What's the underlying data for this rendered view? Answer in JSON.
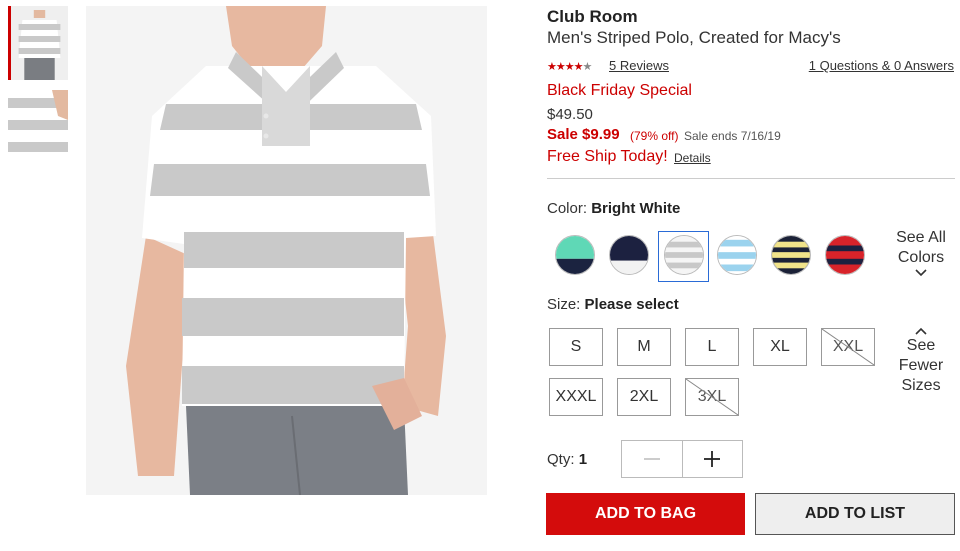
{
  "gallery": {
    "thumbnails": [
      "thumbnail-front",
      "thumbnail-detail"
    ],
    "selected_index": 0,
    "main_image": "striped-polo-model-photo"
  },
  "product": {
    "brand": "Club Room",
    "name": "Men's Striped Polo, Created for Macy's",
    "rating": 4,
    "rating_max": 5,
    "reviews_link": "5 Reviews",
    "qa_link": "1 Questions & 0 Answers",
    "promo": "Black Friday Special",
    "original_price": "$49.50",
    "sale_price": "Sale $9.99",
    "discount": "(79% off)",
    "sale_ends": "Sale ends 7/16/19",
    "free_ship": "Free Ship Today!",
    "details_link": "Details"
  },
  "color": {
    "label": "Color:",
    "selected": "Bright White",
    "swatches": [
      {
        "name": "mint-navy",
        "colors": [
          "#5fd8b6",
          "#1b2340"
        ]
      },
      {
        "name": "navy-white",
        "colors": [
          "#1c2140",
          "#f2f2f2"
        ]
      },
      {
        "name": "bright-white",
        "colors": [
          "#f5f5f5",
          "#c8c8c8"
        ]
      },
      {
        "name": "light-blue-white",
        "colors": [
          "#9bd3ee",
          "#ffffff"
        ]
      },
      {
        "name": "yellow-navy",
        "colors": [
          "#f1e38a",
          "#1b2137"
        ]
      },
      {
        "name": "red-navy",
        "colors": [
          "#d8232a",
          "#1c2140"
        ]
      }
    ],
    "selected_index": 2,
    "see_all": [
      "See All",
      "Colors"
    ]
  },
  "size": {
    "label": "Size:",
    "selected": "Please select",
    "options": [
      {
        "label": "S",
        "available": true
      },
      {
        "label": "M",
        "available": true
      },
      {
        "label": "L",
        "available": true
      },
      {
        "label": "XL",
        "available": true
      },
      {
        "label": "XXL",
        "available": false
      },
      {
        "label": "XXXL",
        "available": true
      },
      {
        "label": "2XL",
        "available": true
      },
      {
        "label": "3XL",
        "available": false
      }
    ],
    "see_fewer": [
      "See",
      "Fewer",
      "Sizes"
    ]
  },
  "quantity": {
    "label": "Qty:",
    "value": "1"
  },
  "actions": {
    "add_to_bag": "ADD TO BAG",
    "add_to_list": "ADD TO LIST"
  },
  "colors": {
    "accent_red": "#d40c0c",
    "selected_border": "#2a6bd6",
    "stripe_gray": "#c9c9c9"
  }
}
